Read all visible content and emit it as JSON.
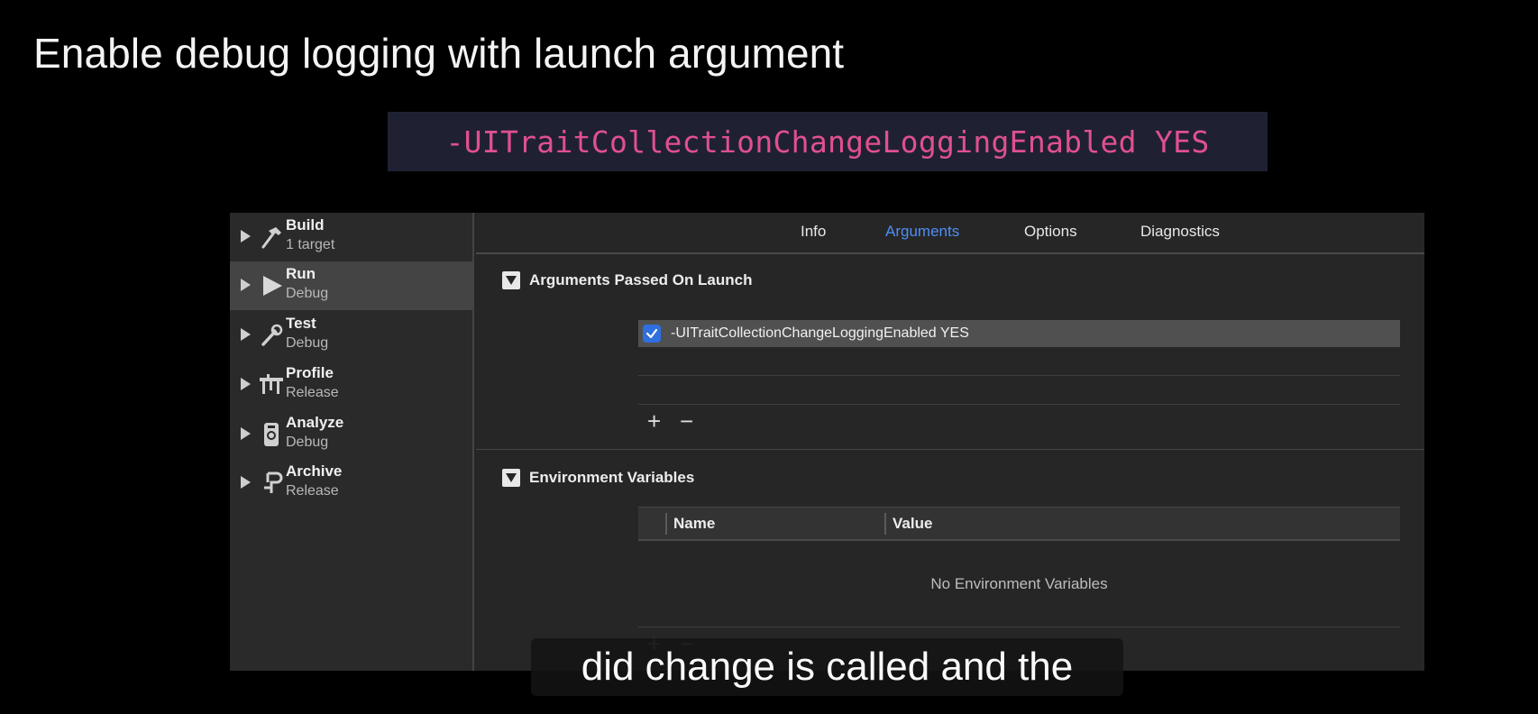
{
  "slide": {
    "title": "Enable debug logging with launch argument",
    "code": "-UITraitCollectionChangeLoggingEnabled YES",
    "code_color": "#e0508f"
  },
  "sidebar": {
    "actions": [
      {
        "name": "Build",
        "sub": "1 target",
        "icon": "hammer-icon"
      },
      {
        "name": "Run",
        "sub": "Debug",
        "icon": "play-icon",
        "selected": true
      },
      {
        "name": "Test",
        "sub": "Debug",
        "icon": "wrench-icon"
      },
      {
        "name": "Profile",
        "sub": "Release",
        "icon": "caliper-icon"
      },
      {
        "name": "Analyze",
        "sub": "Debug",
        "icon": "analyze-icon"
      },
      {
        "name": "Archive",
        "sub": "Release",
        "icon": "archive-icon"
      }
    ]
  },
  "tabs": [
    {
      "label": "Info",
      "active": false
    },
    {
      "label": "Arguments",
      "active": true
    },
    {
      "label": "Options",
      "active": false
    },
    {
      "label": "Diagnostics",
      "active": false
    }
  ],
  "arguments_section": {
    "title": "Arguments Passed On Launch",
    "items": [
      {
        "text": "-UITraitCollectionChangeLoggingEnabled YES",
        "checked": true
      }
    ],
    "add_label": "+",
    "remove_label": "−"
  },
  "environment_section": {
    "title": "Environment Variables",
    "columns": [
      "Name",
      "Value"
    ],
    "empty_message": "No Environment Variables"
  },
  "caption": "did change is called and the",
  "colors": {
    "accent": "#4f8ef7",
    "checkbox": "#2f6fe0"
  }
}
